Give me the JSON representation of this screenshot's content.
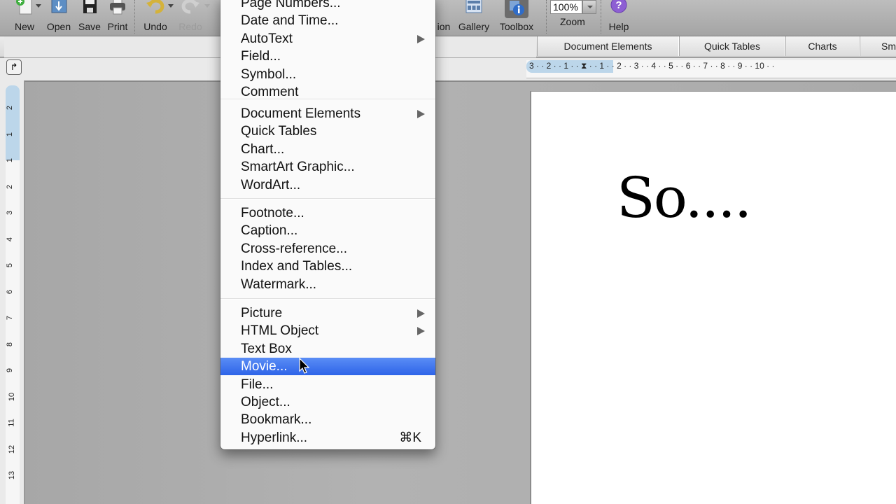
{
  "toolbar": {
    "buttons": [
      {
        "label": "New",
        "icon": "new-document-icon"
      },
      {
        "label": "Open",
        "icon": "open-folder-icon"
      },
      {
        "label": "Save",
        "icon": "save-disk-icon"
      },
      {
        "label": "Print",
        "icon": "printer-icon"
      },
      {
        "label": "Undo",
        "icon": "undo-arrow-icon"
      },
      {
        "label": "Redo",
        "icon": "redo-arrow-icon",
        "disabled": true
      },
      {
        "label": "ion",
        "icon": ""
      },
      {
        "label": "Gallery",
        "icon": "gallery-icon"
      },
      {
        "label": "Toolbox",
        "icon": "toolbox-info-icon"
      },
      {
        "label": "Zoom",
        "icon": ""
      },
      {
        "label": "Help",
        "icon": "help-question-icon"
      }
    ],
    "zoom_value": "100%"
  },
  "ribbon": {
    "tabs": [
      "Document Elements",
      "Quick Tables",
      "Charts",
      "Sm"
    ]
  },
  "ruler": {
    "horizontal": "3 · · 2 · · 1 · · ⧗ · · 1 · · 2 · · 3 · · 4 · · 5 · · 6 · · 7 · · 8 · · 9 · · 10 · ·",
    "vertical": [
      "2",
      "1",
      "1",
      "2",
      "3",
      "4",
      "5",
      "6",
      "7",
      "8",
      "9",
      "10",
      "11",
      "12",
      "13"
    ]
  },
  "document": {
    "text": "So...."
  },
  "insert_menu": {
    "groups": [
      [
        {
          "label": "Page Numbers..."
        },
        {
          "label": "Date and Time..."
        },
        {
          "label": "AutoText",
          "submenu": true
        },
        {
          "label": "Field..."
        },
        {
          "label": "Symbol..."
        },
        {
          "label": "Comment"
        }
      ],
      [
        {
          "label": "Document Elements",
          "submenu": true
        },
        {
          "label": "Quick Tables"
        },
        {
          "label": "Chart..."
        },
        {
          "label": "SmartArt Graphic..."
        },
        {
          "label": "WordArt..."
        }
      ],
      [
        {
          "label": "Footnote..."
        },
        {
          "label": "Caption..."
        },
        {
          "label": "Cross-reference..."
        },
        {
          "label": "Index and Tables..."
        },
        {
          "label": "Watermark..."
        }
      ],
      [
        {
          "label": "Picture",
          "submenu": true
        },
        {
          "label": "HTML Object",
          "submenu": true
        },
        {
          "label": "Text Box"
        },
        {
          "label": "Movie...",
          "highlighted": true
        },
        {
          "label": "File..."
        },
        {
          "label": "Object..."
        },
        {
          "label": "Bookmark..."
        },
        {
          "label": "Hyperlink...",
          "shortcut": "⌘K"
        }
      ]
    ]
  },
  "colors": {
    "highlight": "#3a6ff0",
    "ruler_margin": "#bcd6ea"
  }
}
